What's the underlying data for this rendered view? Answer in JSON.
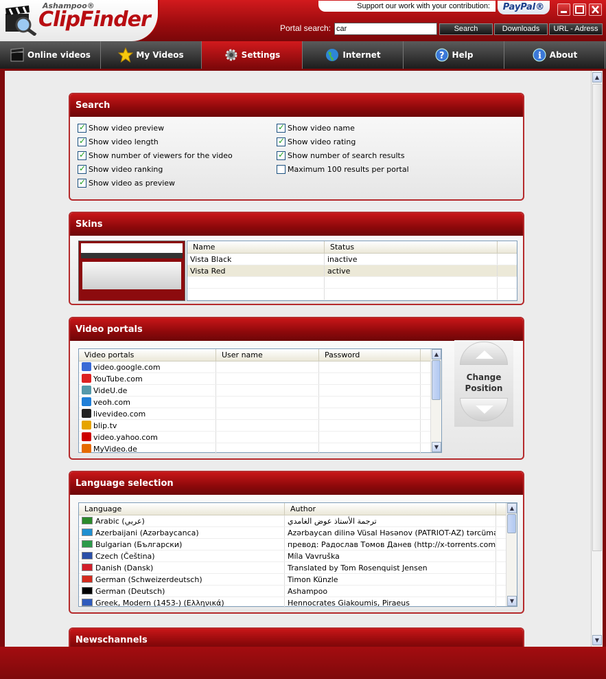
{
  "app": {
    "brand_small": "Ashampoo®",
    "brand_name": "ClipFinder",
    "support_text": "Support our work with your contribution:",
    "paypal_label": "PayPal®",
    "portal_search_label": "Portal search:",
    "portal_search_value": "car",
    "search_button": "Search",
    "downloads_button": "Downloads",
    "url_button": "URL - Adress"
  },
  "tabs": [
    {
      "label": "Online videos",
      "icon": "clapper-icon"
    },
    {
      "label": "My Videos",
      "icon": "star-icon"
    },
    {
      "label": "Settings",
      "icon": "gear-icon"
    },
    {
      "label": "Internet",
      "icon": "globe-icon"
    },
    {
      "label": "Help",
      "icon": "help-icon"
    },
    {
      "label": "About",
      "icon": "info-icon"
    }
  ],
  "search_panel": {
    "title": "Search",
    "options": [
      {
        "label": "Show video preview",
        "checked": true
      },
      {
        "label": "Show video length",
        "checked": true
      },
      {
        "label": "Show number of viewers for the video",
        "checked": true
      },
      {
        "label": "Show video ranking",
        "checked": true
      },
      {
        "label": "Show video as preview",
        "checked": true
      },
      {
        "label": "Show video name",
        "checked": true
      },
      {
        "label": "Show video rating",
        "checked": true
      },
      {
        "label": "Show number of search results",
        "checked": true
      },
      {
        "label": "Maximum 100 results per portal",
        "checked": false
      }
    ]
  },
  "skins_panel": {
    "title": "Skins",
    "columns": [
      "Name",
      "Status"
    ],
    "rows": [
      {
        "name": "Vista Black",
        "status": "inactive"
      },
      {
        "name": "Vista Red",
        "status": "active"
      }
    ]
  },
  "portals_panel": {
    "title": "Video portals",
    "columns": [
      "Video portals",
      "User name",
      "Password"
    ],
    "rows": [
      {
        "name": "video.google.com",
        "icon": "google-icon",
        "color": "#3a6ad6"
      },
      {
        "name": "YouTube.com",
        "icon": "youtube-icon",
        "color": "#d22"
      },
      {
        "name": "VideU.de",
        "icon": "videu-icon",
        "color": "#59a"
      },
      {
        "name": "veoh.com",
        "icon": "veoh-icon",
        "color": "#1f7fd8"
      },
      {
        "name": "livevideo.com",
        "icon": "tv-icon",
        "color": "#222"
      },
      {
        "name": "blip.tv",
        "icon": "blip-icon",
        "color": "#e6a400"
      },
      {
        "name": "video.yahoo.com",
        "icon": "yahoo-icon",
        "color": "#c00"
      },
      {
        "name": "MyVideo.de",
        "icon": "myvideo-icon",
        "color": "#e56a00"
      }
    ],
    "change_position_label": "Change Position"
  },
  "language_panel": {
    "title": "Language selection",
    "columns": [
      "Language",
      "Author"
    ],
    "rows": [
      {
        "language": "Arabic (عربي)",
        "author": "ترجمة الأستاذ عوض الغامدي",
        "flag": "#2b8a2b"
      },
      {
        "language": "Azerbaijani (Azərbaycanca)",
        "author": "Azərbaycan dilinə Vüsal Həsənov (PATRIOT-AZ) tərcümə ed...",
        "flag": "#1f8fd0"
      },
      {
        "language": "Bulgarian (Български)",
        "author": "превод: Радослав Томов Данев (http://x-torrents.com)",
        "flag": "#2c9a4a"
      },
      {
        "language": "Czech (Čeština)",
        "author": "Míla Vavruška",
        "flag": "#2a4fa8"
      },
      {
        "language": "Danish (Dansk)",
        "author": "Translated by Tom Rosenquist Jensen",
        "flag": "#d21f2b"
      },
      {
        "language": "German (Schweizerdeutsch)",
        "author": "Timon Künzle",
        "flag": "#d52b1e"
      },
      {
        "language": "German (Deutsch)",
        "author": "Ashampoo",
        "flag": "#000000"
      },
      {
        "language": "Greek, Modern (1453-) (Ελληνικά)",
        "author": "Hennocrates Giakoumis, Piraeus",
        "flag": "#2f5bbd"
      }
    ]
  },
  "news_panel": {
    "title": "Newschannels"
  }
}
